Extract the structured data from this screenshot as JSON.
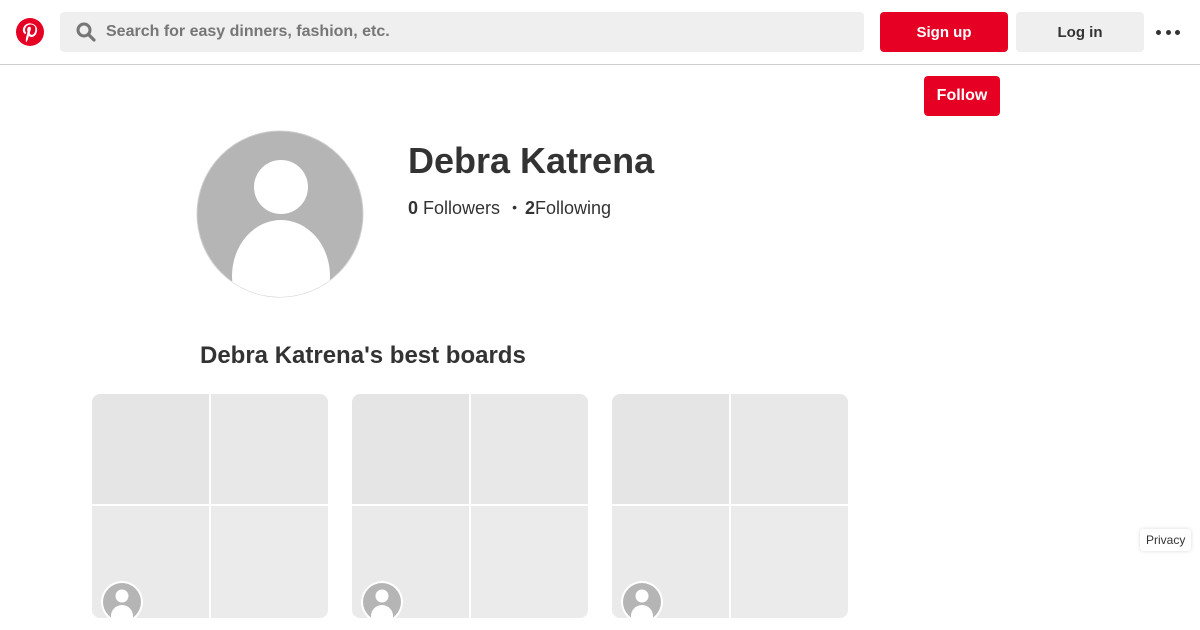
{
  "header": {
    "logo_icon": "pinterest-logo",
    "brand_color": "#e60023",
    "search": {
      "placeholder": "Search for easy dinners, fashion, etc.",
      "value": ""
    },
    "signup_label": "Sign up",
    "login_label": "Log in",
    "more_icon": "more-horizontal-icon"
  },
  "profile": {
    "follow_label": "Follow",
    "name": "Debra Katrena",
    "followers_count": "0",
    "followers_label": "Followers",
    "separator": "•",
    "following_count": "2",
    "following_label": "Following"
  },
  "boards_section": {
    "title": "Debra Katrena's best boards",
    "boards": [
      {
        "owner_icon": "avatar-placeholder-icon"
      },
      {
        "owner_icon": "avatar-placeholder-icon"
      },
      {
        "owner_icon": "avatar-placeholder-icon"
      }
    ]
  },
  "footer": {
    "privacy_label": "Privacy"
  }
}
